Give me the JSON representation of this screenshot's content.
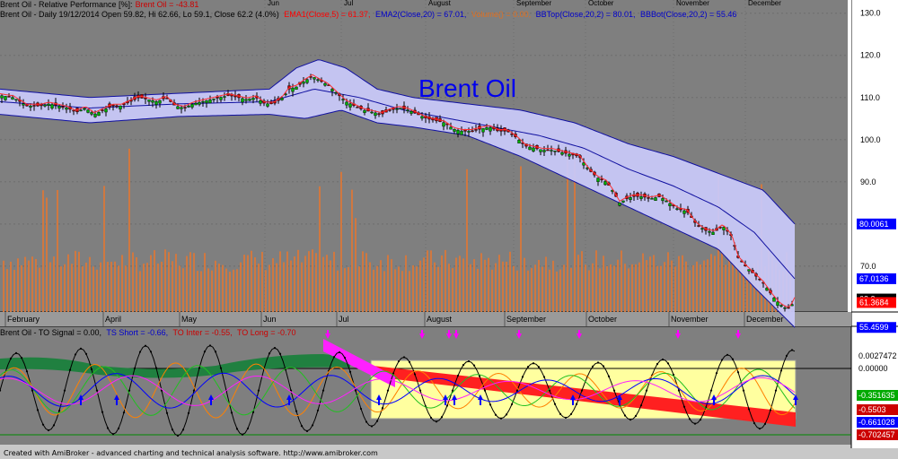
{
  "header_top": {
    "line1_prefix": "Brent Oil - Relative Performance [%]:",
    "line1_value": "Brent Oil = -43.81",
    "line2_quote": "Brent Oil - Daily 19/12/2014 Open 59.82, Hi 62.66, Lo 59.1, Close 62.2 (4.0%)",
    "ema1": "EMA1(Close,5) = 61.37,",
    "ema2": "EMA2(Close,20) = 67.01,",
    "volume": "Volume() = 0.00,",
    "bbtop": "BBTop(Close,20,2) = 80.01,",
    "bbbot": "BBBot(Close,20,2) = 55.46"
  },
  "header_bottom": {
    "name": "Brent Oil - TO Signal = 0.00,",
    "ts_short": "TS Short = -0.66,",
    "to_inter": "TO Inter = -0.55,",
    "to_long": "TO Long = -0.70"
  },
  "footer": "Created with AmiBroker - advanced charting and technical analysis software. http://www.amibroker.com",
  "chart_data": {
    "type": "line",
    "title": "Brent Oil",
    "main_panel": {
      "y_ticks": [
        70.0,
        80.0,
        90.0,
        100.0,
        110.0,
        120.0,
        130.0
      ],
      "y_tick_labels": [
        "70.0",
        "80.0",
        "90.0",
        "100.0",
        "110.0",
        "120.0",
        "130.0"
      ],
      "ylim": [
        57,
        131
      ],
      "months_top": [
        "Jun",
        "Jul",
        "August",
        "September",
        "October",
        "November",
        "December"
      ],
      "months_bottom": [
        "February",
        "April",
        "May",
        "Jun",
        "Jul",
        "August",
        "September",
        "October",
        "November",
        "December"
      ],
      "price_tags": [
        {
          "value": 80.0061,
          "label": "80.0061",
          "color": "#0000ff"
        },
        {
          "value": 67.0136,
          "label": "67.0136",
          "color": "#0000ff"
        },
        {
          "value": 62.2,
          "label": "62.2",
          "color": "#000000"
        },
        {
          "value": 61.3684,
          "label": "61.3684",
          "color": "#ff0000"
        },
        {
          "value": 55.4599,
          "label": "55.4599",
          "color": "#0000ff"
        }
      ],
      "close_anchors": [
        {
          "x": 0,
          "y": 110.5
        },
        {
          "x": 15,
          "y": 110
        },
        {
          "x": 30,
          "y": 108
        },
        {
          "x": 45,
          "y": 108
        },
        {
          "x": 55,
          "y": 108.5
        },
        {
          "x": 65,
          "y": 108
        },
        {
          "x": 75,
          "y": 107.5
        },
        {
          "x": 85,
          "y": 106.5
        },
        {
          "x": 95,
          "y": 107.5
        },
        {
          "x": 105,
          "y": 106
        },
        {
          "x": 115,
          "y": 107
        },
        {
          "x": 125,
          "y": 108
        },
        {
          "x": 135,
          "y": 108
        },
        {
          "x": 145,
          "y": 109
        },
        {
          "x": 155,
          "y": 110
        },
        {
          "x": 165,
          "y": 109.5
        },
        {
          "x": 175,
          "y": 109
        },
        {
          "x": 185,
          "y": 110
        },
        {
          "x": 195,
          "y": 108
        },
        {
          "x": 205,
          "y": 107.5
        },
        {
          "x": 215,
          "y": 108.5
        },
        {
          "x": 225,
          "y": 109
        },
        {
          "x": 235,
          "y": 109.5
        },
        {
          "x": 245,
          "y": 110
        },
        {
          "x": 255,
          "y": 110.5
        },
        {
          "x": 265,
          "y": 110
        },
        {
          "x": 275,
          "y": 109.5
        },
        {
          "x": 285,
          "y": 110
        },
        {
          "x": 295,
          "y": 108.5
        },
        {
          "x": 305,
          "y": 108.5
        },
        {
          "x": 315,
          "y": 110
        },
        {
          "x": 322,
          "y": 112
        },
        {
          "x": 330,
          "y": 112.5
        },
        {
          "x": 340,
          "y": 114
        },
        {
          "x": 348,
          "y": 115
        },
        {
          "x": 356,
          "y": 114
        },
        {
          "x": 365,
          "y": 113
        },
        {
          "x": 375,
          "y": 111
        },
        {
          "x": 385,
          "y": 109
        },
        {
          "x": 395,
          "y": 108
        },
        {
          "x": 405,
          "y": 107
        },
        {
          "x": 415,
          "y": 106.5
        },
        {
          "x": 425,
          "y": 106
        },
        {
          "x": 435,
          "y": 107
        },
        {
          "x": 445,
          "y": 107.5
        },
        {
          "x": 455,
          "y": 107
        },
        {
          "x": 465,
          "y": 106
        },
        {
          "x": 475,
          "y": 105
        },
        {
          "x": 485,
          "y": 104.5
        },
        {
          "x": 495,
          "y": 104
        },
        {
          "x": 505,
          "y": 102.5
        },
        {
          "x": 515,
          "y": 102
        },
        {
          "x": 525,
          "y": 102
        },
        {
          "x": 535,
          "y": 102.5
        },
        {
          "x": 545,
          "y": 103
        },
        {
          "x": 555,
          "y": 102
        },
        {
          "x": 565,
          "y": 102
        },
        {
          "x": 575,
          "y": 100.5
        },
        {
          "x": 585,
          "y": 98.5
        },
        {
          "x": 595,
          "y": 98
        },
        {
          "x": 605,
          "y": 97.5
        },
        {
          "x": 615,
          "y": 97.5
        },
        {
          "x": 625,
          "y": 97
        },
        {
          "x": 635,
          "y": 96.5
        },
        {
          "x": 645,
          "y": 96
        },
        {
          "x": 655,
          "y": 93
        },
        {
          "x": 665,
          "y": 91
        },
        {
          "x": 675,
          "y": 90
        },
        {
          "x": 682,
          "y": 88
        },
        {
          "x": 690,
          "y": 85
        },
        {
          "x": 698,
          "y": 86
        },
        {
          "x": 705,
          "y": 86.5
        },
        {
          "x": 715,
          "y": 86.5
        },
        {
          "x": 725,
          "y": 86
        },
        {
          "x": 735,
          "y": 86.5
        },
        {
          "x": 745,
          "y": 85
        },
        {
          "x": 755,
          "y": 83.5
        },
        {
          "x": 765,
          "y": 83
        },
        {
          "x": 775,
          "y": 80
        },
        {
          "x": 785,
          "y": 78.5
        },
        {
          "x": 795,
          "y": 78
        },
        {
          "x": 805,
          "y": 79.5
        },
        {
          "x": 815,
          "y": 77
        },
        {
          "x": 822,
          "y": 72
        },
        {
          "x": 830,
          "y": 70
        },
        {
          "x": 840,
          "y": 68
        },
        {
          "x": 850,
          "y": 66
        },
        {
          "x": 860,
          "y": 63
        },
        {
          "x": 868,
          "y": 61
        },
        {
          "x": 875,
          "y": 60
        },
        {
          "x": 880,
          "y": 60
        },
        {
          "x": 885,
          "y": 62.2
        }
      ],
      "ema20_anchors": [
        {
          "x": 0,
          "y": 109
        },
        {
          "x": 100,
          "y": 107.5
        },
        {
          "x": 200,
          "y": 108.5
        },
        {
          "x": 300,
          "y": 109
        },
        {
          "x": 350,
          "y": 112
        },
        {
          "x": 400,
          "y": 110
        },
        {
          "x": 450,
          "y": 107
        },
        {
          "x": 500,
          "y": 105
        },
        {
          "x": 550,
          "y": 103
        },
        {
          "x": 600,
          "y": 101
        },
        {
          "x": 650,
          "y": 98
        },
        {
          "x": 700,
          "y": 93
        },
        {
          "x": 750,
          "y": 89
        },
        {
          "x": 800,
          "y": 84
        },
        {
          "x": 840,
          "y": 78
        },
        {
          "x": 885,
          "y": 67.0136
        }
      ],
      "bb_top_anchors": [
        {
          "x": 0,
          "y": 112
        },
        {
          "x": 100,
          "y": 110
        },
        {
          "x": 200,
          "y": 111
        },
        {
          "x": 300,
          "y": 112
        },
        {
          "x": 330,
          "y": 117
        },
        {
          "x": 355,
          "y": 119
        },
        {
          "x": 385,
          "y": 117
        },
        {
          "x": 420,
          "y": 112
        },
        {
          "x": 460,
          "y": 110
        },
        {
          "x": 520,
          "y": 108.5
        },
        {
          "x": 580,
          "y": 107
        },
        {
          "x": 640,
          "y": 104
        },
        {
          "x": 700,
          "y": 99
        },
        {
          "x": 750,
          "y": 96
        },
        {
          "x": 800,
          "y": 92
        },
        {
          "x": 850,
          "y": 88
        },
        {
          "x": 885,
          "y": 80.0061
        }
      ],
      "bb_bot_anchors": [
        {
          "x": 0,
          "y": 106
        },
        {
          "x": 100,
          "y": 104
        },
        {
          "x": 200,
          "y": 105.5
        },
        {
          "x": 300,
          "y": 106
        },
        {
          "x": 340,
          "y": 105
        },
        {
          "x": 380,
          "y": 107
        },
        {
          "x": 420,
          "y": 104
        },
        {
          "x": 460,
          "y": 103
        },
        {
          "x": 520,
          "y": 101
        },
        {
          "x": 580,
          "y": 96
        },
        {
          "x": 640,
          "y": 90
        },
        {
          "x": 700,
          "y": 84
        },
        {
          "x": 760,
          "y": 78
        },
        {
          "x": 800,
          "y": 74
        },
        {
          "x": 840,
          "y": 65
        },
        {
          "x": 885,
          "y": 55.4599
        }
      ]
    },
    "oscillator_panel": {
      "tags": [
        {
          "label": "0.0027472",
          "color": "#000000"
        },
        {
          "label": "0.00000",
          "color": "#000000"
        },
        {
          "label": "-0.351635",
          "color": "#00aa00"
        },
        {
          "label": "-0.5503",
          "color": "#cc0000"
        },
        {
          "label": "-0.661028",
          "color": "#0000ff"
        },
        {
          "label": "-0.702457",
          "color": "#cc0000"
        }
      ]
    }
  }
}
